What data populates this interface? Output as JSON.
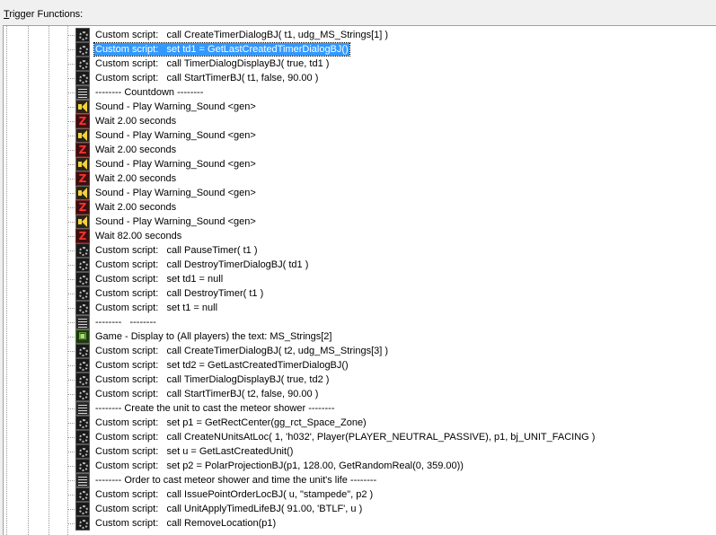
{
  "header": {
    "label_accel": "T",
    "label_rest": "rigger Functions:"
  },
  "rows": [
    {
      "icon": "script",
      "text": "Custom script:   call CreateTimerDialogBJ( t1, udg_MS_Strings[1] )"
    },
    {
      "icon": "script",
      "text": "Custom script:   set td1 = GetLastCreatedTimerDialogBJ()",
      "selected": true
    },
    {
      "icon": "script",
      "text": "Custom script:   call TimerDialogDisplayBJ( true, td1 )"
    },
    {
      "icon": "script",
      "text": "Custom script:   call StartTimerBJ( t1, false, 90.00 )"
    },
    {
      "icon": "comment",
      "text": "-------- Countdown --------"
    },
    {
      "icon": "sound",
      "text": "Sound - Play Warning_Sound <gen>"
    },
    {
      "icon": "wait",
      "text": "Wait 2.00 seconds"
    },
    {
      "icon": "sound",
      "text": "Sound - Play Warning_Sound <gen>"
    },
    {
      "icon": "wait",
      "text": "Wait 2.00 seconds"
    },
    {
      "icon": "sound",
      "text": "Sound - Play Warning_Sound <gen>"
    },
    {
      "icon": "wait",
      "text": "Wait 2.00 seconds"
    },
    {
      "icon": "sound",
      "text": "Sound - Play Warning_Sound <gen>"
    },
    {
      "icon": "wait",
      "text": "Wait 2.00 seconds"
    },
    {
      "icon": "sound",
      "text": "Sound - Play Warning_Sound <gen>"
    },
    {
      "icon": "wait",
      "text": "Wait 82.00 seconds"
    },
    {
      "icon": "script",
      "text": "Custom script:   call PauseTimer( t1 )"
    },
    {
      "icon": "script",
      "text": "Custom script:   call DestroyTimerDialogBJ( td1 )"
    },
    {
      "icon": "script",
      "text": "Custom script:   set td1 = null"
    },
    {
      "icon": "script",
      "text": "Custom script:   call DestroyTimer( t1 )"
    },
    {
      "icon": "script",
      "text": "Custom script:   set t1 = null"
    },
    {
      "icon": "comment",
      "text": "--------   --------"
    },
    {
      "icon": "game",
      "text": "Game - Display to (All players) the text: MS_Strings[2]"
    },
    {
      "icon": "script",
      "text": "Custom script:   call CreateTimerDialogBJ( t2, udg_MS_Strings[3] )"
    },
    {
      "icon": "script",
      "text": "Custom script:   set td2 = GetLastCreatedTimerDialogBJ()"
    },
    {
      "icon": "script",
      "text": "Custom script:   call TimerDialogDisplayBJ( true, td2 )"
    },
    {
      "icon": "script",
      "text": "Custom script:   call StartTimerBJ( t2, false, 90.00 )"
    },
    {
      "icon": "comment",
      "text": "-------- Create the unit to cast the meteor shower --------"
    },
    {
      "icon": "script",
      "text": "Custom script:   set p1 = GetRectCenter(gg_rct_Space_Zone)"
    },
    {
      "icon": "script",
      "text": "Custom script:   call CreateNUnitsAtLoc( 1, 'h032', Player(PLAYER_NEUTRAL_PASSIVE), p1, bj_UNIT_FACING )"
    },
    {
      "icon": "script",
      "text": "Custom script:   set u = GetLastCreatedUnit()"
    },
    {
      "icon": "script",
      "text": "Custom script:   set p2 = PolarProjectionBJ(p1, 128.00, GetRandomReal(0, 359.00))"
    },
    {
      "icon": "comment",
      "text": "-------- Order to cast meteor shower and time the unit's life --------"
    },
    {
      "icon": "script",
      "text": "Custom script:   call IssuePointOrderLocBJ( u, \"stampede\", p2 )"
    },
    {
      "icon": "script",
      "text": "Custom script:   call UnitApplyTimedLifeBJ( 91.00, 'BTLF', u )"
    },
    {
      "icon": "script",
      "text": "Custom script:   call RemoveLocation(p1)"
    }
  ]
}
